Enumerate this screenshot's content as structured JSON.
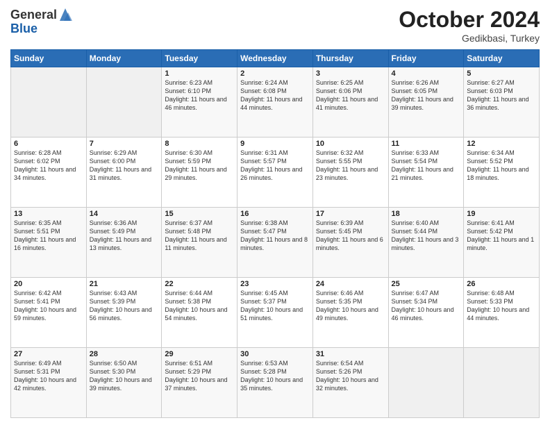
{
  "header": {
    "logo_general": "General",
    "logo_blue": "Blue",
    "month_title": "October 2024",
    "location": "Gedikbasi, Turkey"
  },
  "weekdays": [
    "Sunday",
    "Monday",
    "Tuesday",
    "Wednesday",
    "Thursday",
    "Friday",
    "Saturday"
  ],
  "weeks": [
    [
      {
        "day": "",
        "sunrise": "",
        "sunset": "",
        "daylight": ""
      },
      {
        "day": "",
        "sunrise": "",
        "sunset": "",
        "daylight": ""
      },
      {
        "day": "1",
        "sunrise": "Sunrise: 6:23 AM",
        "sunset": "Sunset: 6:10 PM",
        "daylight": "Daylight: 11 hours and 46 minutes."
      },
      {
        "day": "2",
        "sunrise": "Sunrise: 6:24 AM",
        "sunset": "Sunset: 6:08 PM",
        "daylight": "Daylight: 11 hours and 44 minutes."
      },
      {
        "day": "3",
        "sunrise": "Sunrise: 6:25 AM",
        "sunset": "Sunset: 6:06 PM",
        "daylight": "Daylight: 11 hours and 41 minutes."
      },
      {
        "day": "4",
        "sunrise": "Sunrise: 6:26 AM",
        "sunset": "Sunset: 6:05 PM",
        "daylight": "Daylight: 11 hours and 39 minutes."
      },
      {
        "day": "5",
        "sunrise": "Sunrise: 6:27 AM",
        "sunset": "Sunset: 6:03 PM",
        "daylight": "Daylight: 11 hours and 36 minutes."
      }
    ],
    [
      {
        "day": "6",
        "sunrise": "Sunrise: 6:28 AM",
        "sunset": "Sunset: 6:02 PM",
        "daylight": "Daylight: 11 hours and 34 minutes."
      },
      {
        "day": "7",
        "sunrise": "Sunrise: 6:29 AM",
        "sunset": "Sunset: 6:00 PM",
        "daylight": "Daylight: 11 hours and 31 minutes."
      },
      {
        "day": "8",
        "sunrise": "Sunrise: 6:30 AM",
        "sunset": "Sunset: 5:59 PM",
        "daylight": "Daylight: 11 hours and 29 minutes."
      },
      {
        "day": "9",
        "sunrise": "Sunrise: 6:31 AM",
        "sunset": "Sunset: 5:57 PM",
        "daylight": "Daylight: 11 hours and 26 minutes."
      },
      {
        "day": "10",
        "sunrise": "Sunrise: 6:32 AM",
        "sunset": "Sunset: 5:55 PM",
        "daylight": "Daylight: 11 hours and 23 minutes."
      },
      {
        "day": "11",
        "sunrise": "Sunrise: 6:33 AM",
        "sunset": "Sunset: 5:54 PM",
        "daylight": "Daylight: 11 hours and 21 minutes."
      },
      {
        "day": "12",
        "sunrise": "Sunrise: 6:34 AM",
        "sunset": "Sunset: 5:52 PM",
        "daylight": "Daylight: 11 hours and 18 minutes."
      }
    ],
    [
      {
        "day": "13",
        "sunrise": "Sunrise: 6:35 AM",
        "sunset": "Sunset: 5:51 PM",
        "daylight": "Daylight: 11 hours and 16 minutes."
      },
      {
        "day": "14",
        "sunrise": "Sunrise: 6:36 AM",
        "sunset": "Sunset: 5:49 PM",
        "daylight": "Daylight: 11 hours and 13 minutes."
      },
      {
        "day": "15",
        "sunrise": "Sunrise: 6:37 AM",
        "sunset": "Sunset: 5:48 PM",
        "daylight": "Daylight: 11 hours and 11 minutes."
      },
      {
        "day": "16",
        "sunrise": "Sunrise: 6:38 AM",
        "sunset": "Sunset: 5:47 PM",
        "daylight": "Daylight: 11 hours and 8 minutes."
      },
      {
        "day": "17",
        "sunrise": "Sunrise: 6:39 AM",
        "sunset": "Sunset: 5:45 PM",
        "daylight": "Daylight: 11 hours and 6 minutes."
      },
      {
        "day": "18",
        "sunrise": "Sunrise: 6:40 AM",
        "sunset": "Sunset: 5:44 PM",
        "daylight": "Daylight: 11 hours and 3 minutes."
      },
      {
        "day": "19",
        "sunrise": "Sunrise: 6:41 AM",
        "sunset": "Sunset: 5:42 PM",
        "daylight": "Daylight: 11 hours and 1 minute."
      }
    ],
    [
      {
        "day": "20",
        "sunrise": "Sunrise: 6:42 AM",
        "sunset": "Sunset: 5:41 PM",
        "daylight": "Daylight: 10 hours and 59 minutes."
      },
      {
        "day": "21",
        "sunrise": "Sunrise: 6:43 AM",
        "sunset": "Sunset: 5:39 PM",
        "daylight": "Daylight: 10 hours and 56 minutes."
      },
      {
        "day": "22",
        "sunrise": "Sunrise: 6:44 AM",
        "sunset": "Sunset: 5:38 PM",
        "daylight": "Daylight: 10 hours and 54 minutes."
      },
      {
        "day": "23",
        "sunrise": "Sunrise: 6:45 AM",
        "sunset": "Sunset: 5:37 PM",
        "daylight": "Daylight: 10 hours and 51 minutes."
      },
      {
        "day": "24",
        "sunrise": "Sunrise: 6:46 AM",
        "sunset": "Sunset: 5:35 PM",
        "daylight": "Daylight: 10 hours and 49 minutes."
      },
      {
        "day": "25",
        "sunrise": "Sunrise: 6:47 AM",
        "sunset": "Sunset: 5:34 PM",
        "daylight": "Daylight: 10 hours and 46 minutes."
      },
      {
        "day": "26",
        "sunrise": "Sunrise: 6:48 AM",
        "sunset": "Sunset: 5:33 PM",
        "daylight": "Daylight: 10 hours and 44 minutes."
      }
    ],
    [
      {
        "day": "27",
        "sunrise": "Sunrise: 6:49 AM",
        "sunset": "Sunset: 5:31 PM",
        "daylight": "Daylight: 10 hours and 42 minutes."
      },
      {
        "day": "28",
        "sunrise": "Sunrise: 6:50 AM",
        "sunset": "Sunset: 5:30 PM",
        "daylight": "Daylight: 10 hours and 39 minutes."
      },
      {
        "day": "29",
        "sunrise": "Sunrise: 6:51 AM",
        "sunset": "Sunset: 5:29 PM",
        "daylight": "Daylight: 10 hours and 37 minutes."
      },
      {
        "day": "30",
        "sunrise": "Sunrise: 6:53 AM",
        "sunset": "Sunset: 5:28 PM",
        "daylight": "Daylight: 10 hours and 35 minutes."
      },
      {
        "day": "31",
        "sunrise": "Sunrise: 6:54 AM",
        "sunset": "Sunset: 5:26 PM",
        "daylight": "Daylight: 10 hours and 32 minutes."
      },
      {
        "day": "",
        "sunrise": "",
        "sunset": "",
        "daylight": ""
      },
      {
        "day": "",
        "sunrise": "",
        "sunset": "",
        "daylight": ""
      }
    ]
  ]
}
